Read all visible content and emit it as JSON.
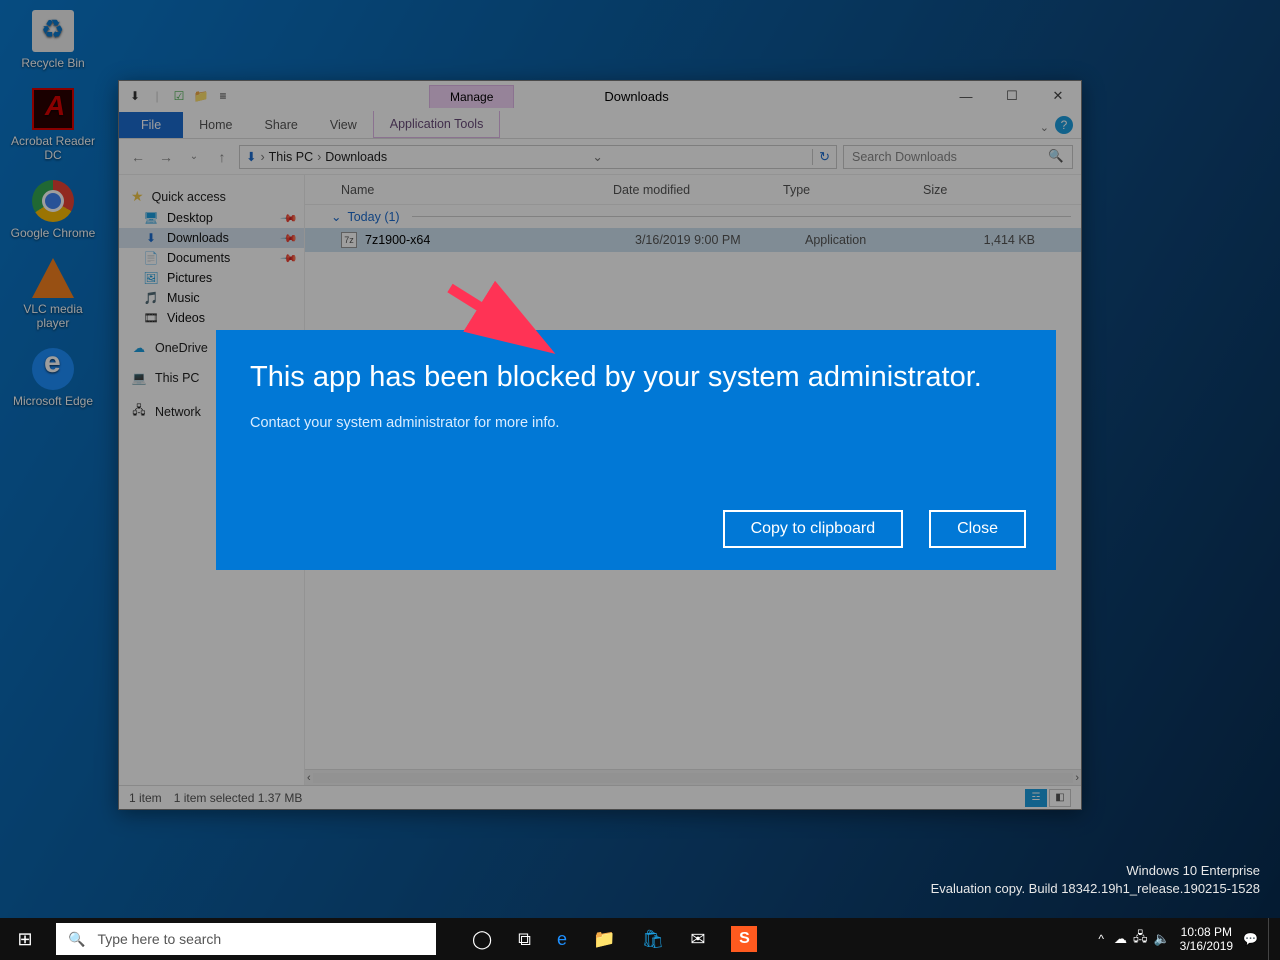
{
  "desktop": {
    "icons": [
      {
        "label": "Recycle Bin"
      },
      {
        "label": "Acrobat Reader DC"
      },
      {
        "label": "Google Chrome"
      },
      {
        "label": "VLC media player"
      },
      {
        "label": "Microsoft Edge"
      }
    ]
  },
  "explorer": {
    "title": "Downloads",
    "manage_label": "Manage",
    "tabs": {
      "file": "File",
      "home": "Home",
      "share": "Share",
      "view": "View",
      "app": "Application Tools"
    },
    "breadcrumb": {
      "root": "This PC",
      "folder": "Downloads"
    },
    "search_placeholder": "Search Downloads",
    "sidebar": {
      "quick_access": "Quick access",
      "items": [
        "Desktop",
        "Downloads",
        "Documents",
        "Pictures",
        "Music",
        "Videos"
      ],
      "onedrive": "OneDrive",
      "thispc": "This PC",
      "network": "Network"
    },
    "columns": {
      "name": "Name",
      "modified": "Date modified",
      "type": "Type",
      "size": "Size"
    },
    "group": "Today (1)",
    "row": {
      "name": "7z1900-x64",
      "modified": "3/16/2019 9:00 PM",
      "type": "Application",
      "size": "1,414 KB"
    },
    "status": {
      "items": "1 item",
      "selected": "1 item selected  1.37 MB"
    }
  },
  "modal": {
    "title": "This app has been blocked by your system administrator.",
    "subtitle": "Contact your system administrator for more info.",
    "copy": "Copy to clipboard",
    "close": "Close"
  },
  "watermark": {
    "line1": "Windows 10 Enterprise",
    "line2": "Evaluation copy. Build 18342.19h1_release.190215-1528"
  },
  "taskbar": {
    "search_placeholder": "Type here to search",
    "clock_time": "10:08 PM",
    "clock_date": "3/16/2019"
  }
}
